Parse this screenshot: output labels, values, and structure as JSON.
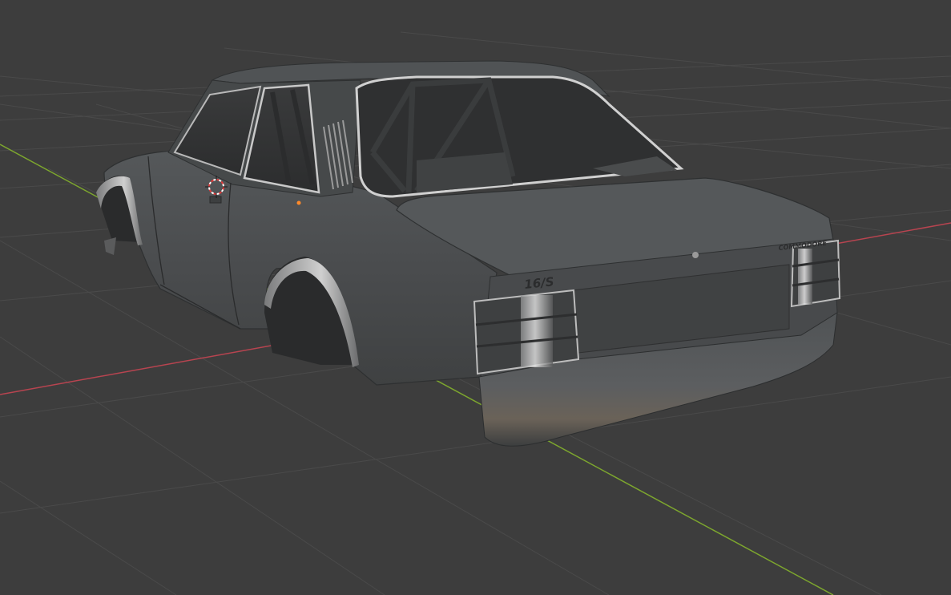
{
  "app": {
    "view": "3d-viewport",
    "background_color": "#3d3d3d",
    "grid_color": "#4b4b4b",
    "x_axis_color": "#c0424b",
    "y_axis_color": "#7fa82c",
    "origin_color": "#ff8a2a",
    "cursor_color": "#e23b3b"
  },
  "model": {
    "name": "car-body",
    "body_color": "#4a4c4d",
    "trim_badge": "16/S",
    "rear_badge": "COMMODORE"
  }
}
